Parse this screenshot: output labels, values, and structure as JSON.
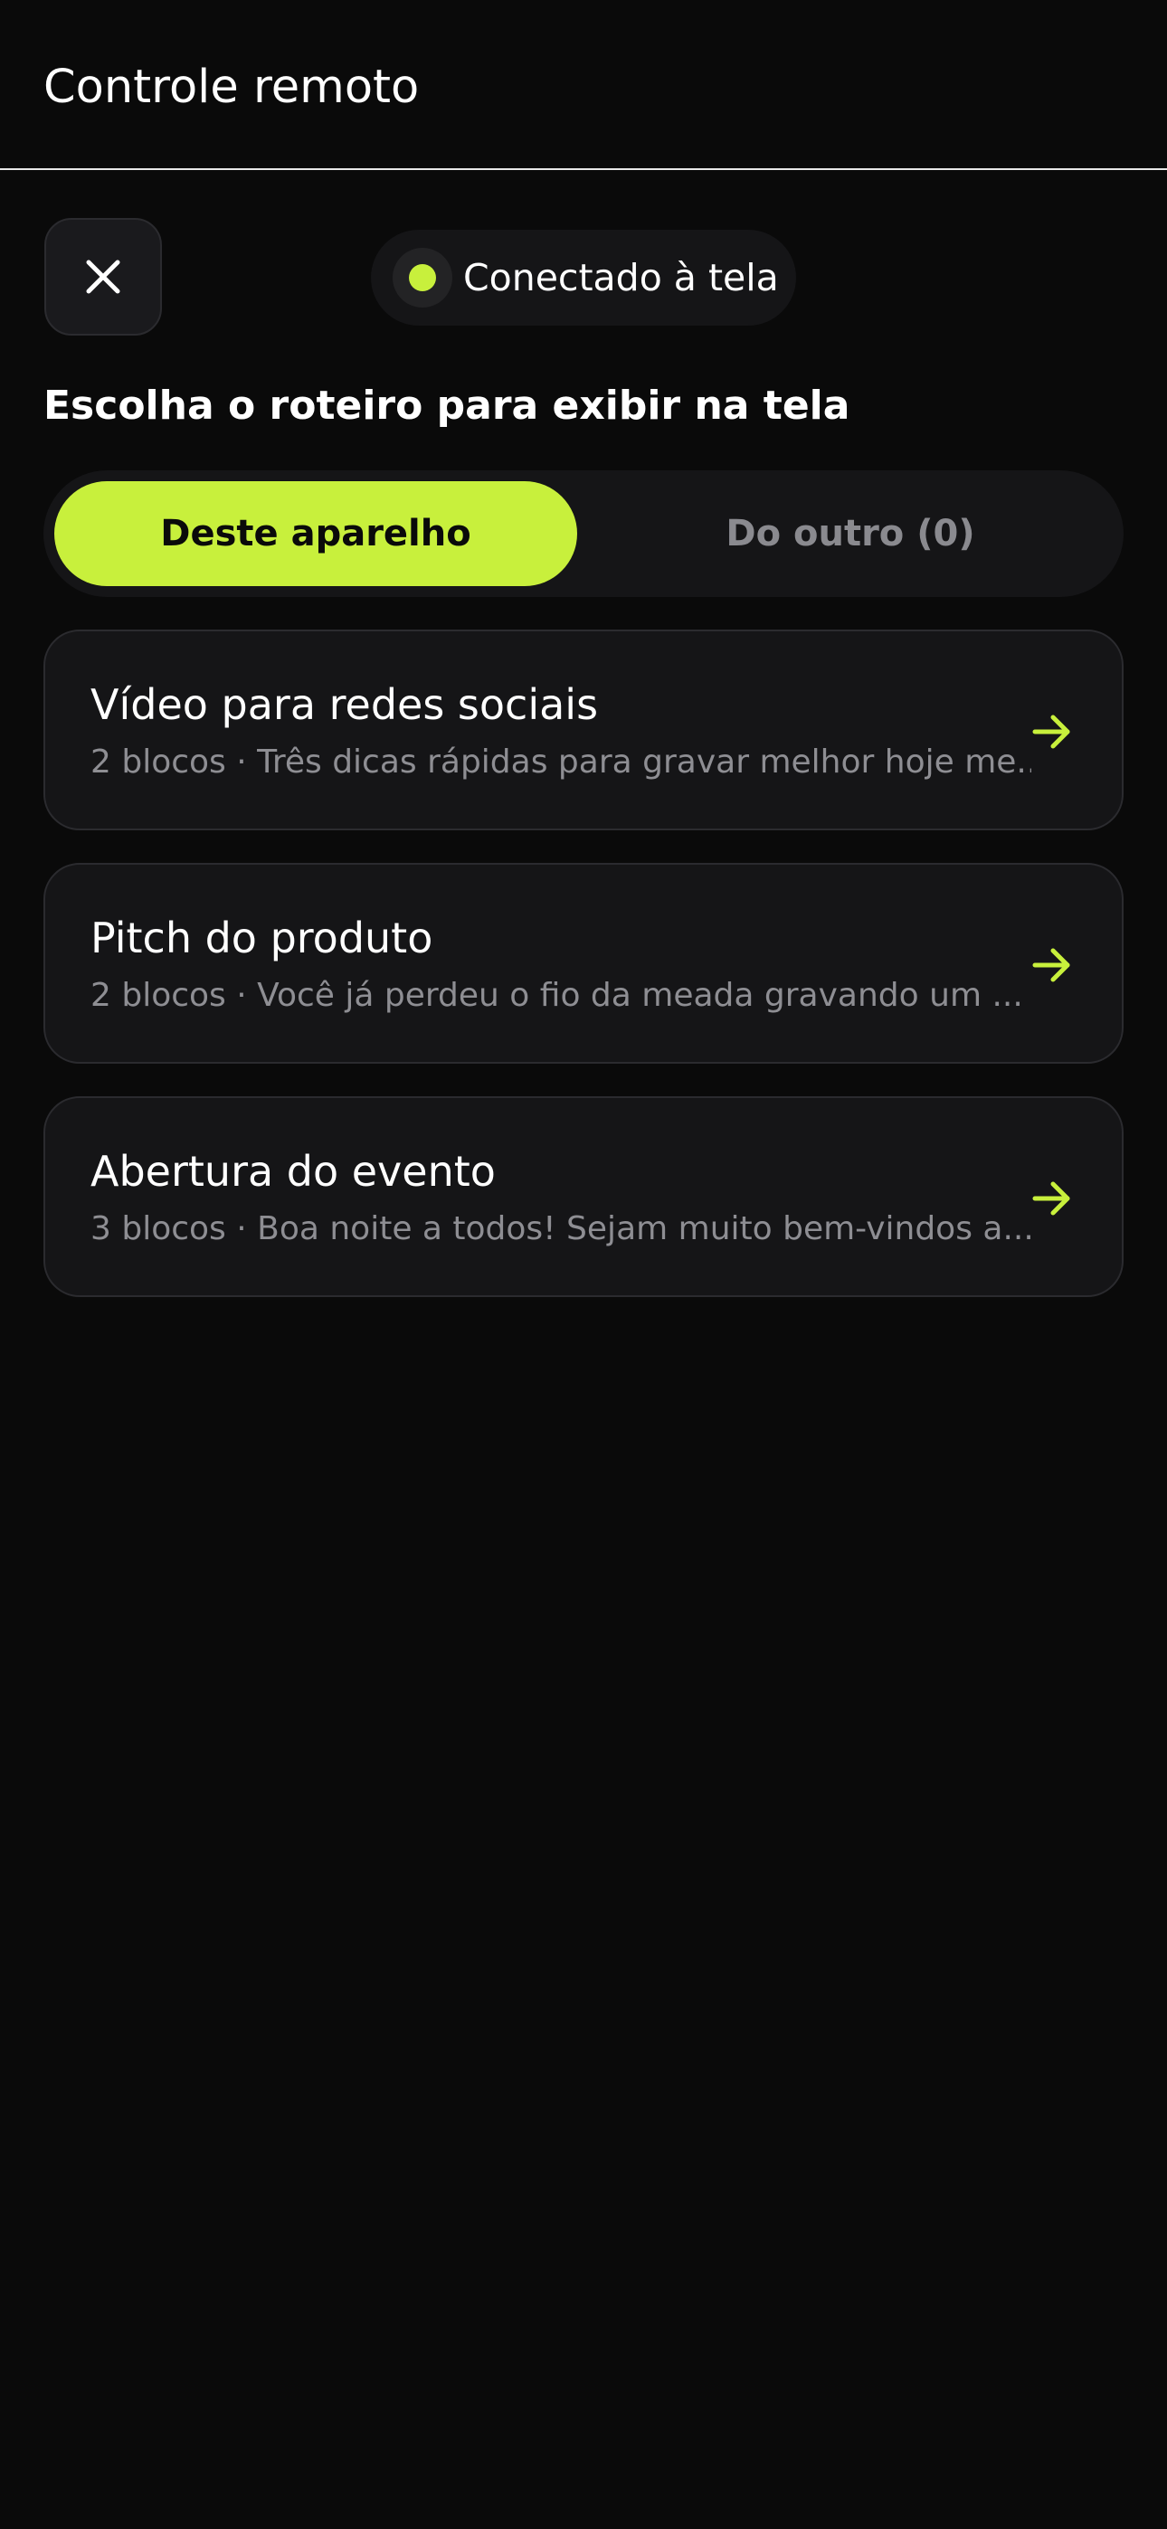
{
  "header": {
    "title": "Controle remoto"
  },
  "toolbar": {
    "close_icon": "close-icon"
  },
  "connection": {
    "status_text": "Conectado à tela",
    "status_color": "#c8f03c"
  },
  "section": {
    "heading": "Escolha o roteiro para exibir na tela"
  },
  "tabs": [
    {
      "label": "Deste aparelho",
      "selected": true
    },
    {
      "label": "Do outro (0)",
      "selected": false
    }
  ],
  "scripts": [
    {
      "title": "Vídeo para redes sociais",
      "subtitle": "2 blocos · Três dicas rápidas para gravar melhor hoje me..."
    },
    {
      "title": "Pitch do produto",
      "subtitle": "2 blocos · Você já perdeu o fio da meada gravando um ..."
    },
    {
      "title": "Abertura do evento",
      "subtitle": "3 blocos · Boa noite a todos! Sejam muito bem-vindos a..."
    }
  ],
  "colors": {
    "accent": "#c8f03c",
    "background": "#0a0a0a",
    "card": "#151517"
  }
}
